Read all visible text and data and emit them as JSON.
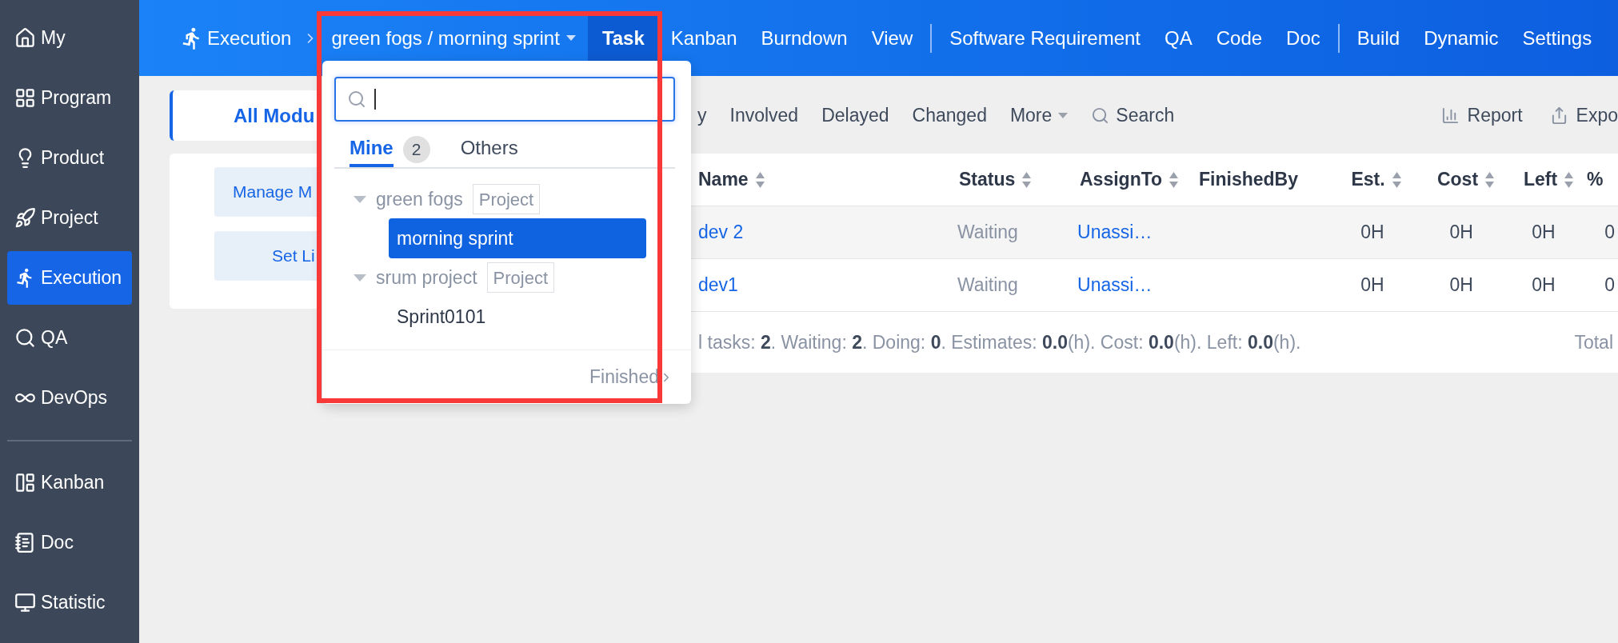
{
  "sidebar": {
    "items": [
      {
        "label": "My",
        "selected": false
      },
      {
        "label": "Program",
        "selected": false
      },
      {
        "label": "Product",
        "selected": false
      },
      {
        "label": "Project",
        "selected": false
      },
      {
        "label": "Execution",
        "selected": true
      },
      {
        "label": "QA",
        "selected": false
      },
      {
        "label": "DevOps",
        "selected": false
      }
    ],
    "tools": [
      {
        "label": "Kanban",
        "selected": false
      },
      {
        "label": "Doc",
        "selected": false
      },
      {
        "label": "Statistic",
        "selected": false
      }
    ]
  },
  "top_nav": {
    "module": "Execution",
    "breadcrumb": "green fogs / morning sprint",
    "groups": [
      {
        "tabs": [
          {
            "label": "Task",
            "selected": true
          },
          {
            "label": "Kanban",
            "selected": false
          },
          {
            "label": "Burndown",
            "selected": false
          },
          {
            "label": "View",
            "selected": false
          }
        ]
      },
      {
        "tabs": [
          {
            "label": "Software Requirement",
            "selected": false
          },
          {
            "label": "QA",
            "selected": false
          },
          {
            "label": "Code",
            "selected": false
          },
          {
            "label": "Doc",
            "selected": false
          }
        ]
      },
      {
        "tabs": [
          {
            "label": "Build",
            "selected": false
          },
          {
            "label": "Dynamic",
            "selected": false
          },
          {
            "label": "Settings",
            "selected": false
          }
        ]
      }
    ]
  },
  "module_panel": {
    "all_modules": "All Modu",
    "buttons": [
      "Manage M",
      "Set Li"
    ]
  },
  "toolbar": {
    "filters": [
      "y",
      "Involved",
      "Delayed",
      "Changed"
    ],
    "more": "More",
    "search": "Search",
    "actions": [
      "Report",
      "Expo"
    ]
  },
  "table": {
    "columns": [
      {
        "label": "Name",
        "sortable": true
      },
      {
        "label": "Status",
        "sortable": true
      },
      {
        "label": "AssignTo",
        "sortable": true
      },
      {
        "label": "FinishedBy",
        "sortable": false
      },
      {
        "label": "Est.",
        "sortable": true
      },
      {
        "label": "Cost",
        "sortable": true
      },
      {
        "label": "Left",
        "sortable": true
      },
      {
        "label": "%",
        "sortable": false
      }
    ],
    "rows": [
      {
        "name": "dev 2",
        "status": "Waiting",
        "assign_to": "Unassi…",
        "est": "0H",
        "cost": "0H",
        "left": "0H",
        "percent": "0"
      },
      {
        "name": "dev1",
        "status": "Waiting",
        "assign_to": "Unassi…",
        "est": "0H",
        "cost": "0H",
        "left": "0H",
        "percent": "0"
      }
    ],
    "summary": "l tasks: **2**. Waiting: **2**. Doing: **0**. Estimates: **0.0**(h). Cost: **0.0**(h). Left: **0.0**(h).",
    "summary_total": "Total"
  },
  "dropdown": {
    "tabs": [
      {
        "label": "Mine",
        "count": "2",
        "selected": true
      },
      {
        "label": "Others",
        "selected": false
      }
    ],
    "tree": [
      {
        "label": "green fogs",
        "tag": "Project",
        "expanded": true,
        "children": [
          {
            "label": "morning sprint",
            "selected": true
          }
        ]
      },
      {
        "label": "srum project",
        "tag": "Project",
        "expanded": true,
        "children": [
          {
            "label": "Sprint0101",
            "selected": false
          }
        ]
      }
    ],
    "footer": "Finished"
  }
}
